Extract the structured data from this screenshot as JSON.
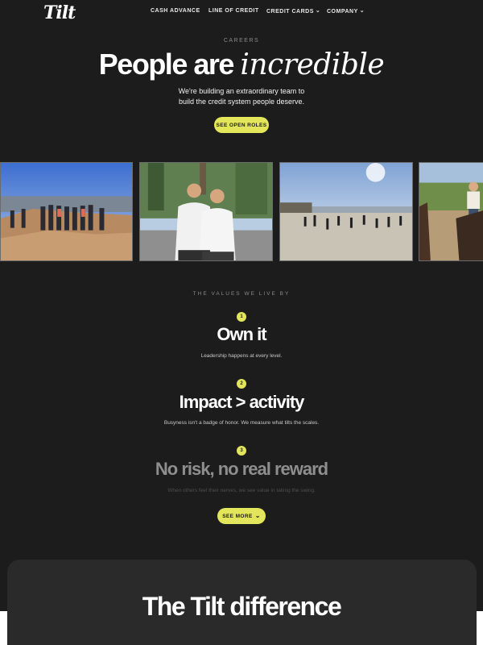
{
  "nav": {
    "logo": "Tilt",
    "items": [
      {
        "label": "CASH ADVANCE",
        "chevron": ""
      },
      {
        "label": "LINE OF CREDIT",
        "chevron": ""
      },
      {
        "label": "CREDIT CARDS",
        "chevron": "⌄"
      },
      {
        "label": "COMPANY",
        "chevron": "⌄"
      }
    ]
  },
  "hero": {
    "eyebrow": "CAREERS",
    "title_plain": "People are ",
    "title_italic": "incredible",
    "subtitle_line1": "We're building an extraordinary team to",
    "subtitle_line2": "build the credit system people deserve.",
    "cta": "SEE OPEN ROLES"
  },
  "photos": [
    {
      "icon": "group-hike-photo"
    },
    {
      "icon": "two-people-photo"
    },
    {
      "icon": "beach-group-photo"
    },
    {
      "icon": "horse-riding-photo"
    }
  ],
  "values": {
    "eyebrow": "THE VALUES WE LIVE BY",
    "items": [
      {
        "number": "1",
        "title": "Own it",
        "description": "Leadership happens at every level."
      },
      {
        "number": "2",
        "title": "Impact > activity",
        "description": "Busyness isn't a badge of honor. We measure what tilts the scales."
      },
      {
        "number": "3",
        "title": "No risk, no real reward",
        "description": "When others feel their nerves, we see value in taking the swing."
      }
    ],
    "see_more": "SEE MORE",
    "see_more_chevron": "⌄"
  },
  "difference": {
    "title": "The Tilt difference"
  },
  "colors": {
    "background": "#1c1c1c",
    "accent": "#e3e65a",
    "card": "#2a2a2a"
  }
}
